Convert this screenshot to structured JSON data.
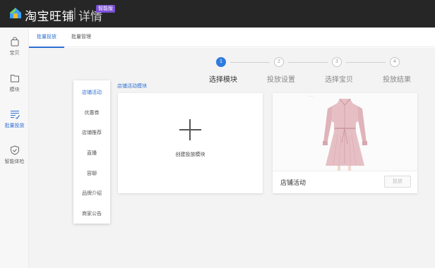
{
  "header": {
    "brand": "淘宝旺铺",
    "separator": "|",
    "subtitle": "详情",
    "badge": "智能版"
  },
  "sidebar": {
    "items": [
      {
        "label": "宝贝",
        "icon": "bag-icon",
        "active": false
      },
      {
        "label": "模块",
        "icon": "folder-icon",
        "active": false
      },
      {
        "label": "批量投放",
        "icon": "list-edit-icon",
        "active": true
      },
      {
        "label": "智能体检",
        "icon": "shield-check-icon",
        "active": false
      }
    ]
  },
  "tabs": [
    {
      "label": "批量投放",
      "active": true
    },
    {
      "label": "批量管理",
      "active": false
    }
  ],
  "steps": [
    {
      "number": "1",
      "label": "选择模块",
      "status": "current"
    },
    {
      "number": "2",
      "label": "投放设置",
      "status": "todo"
    },
    {
      "number": "3",
      "label": "选择宝贝",
      "status": "todo"
    },
    {
      "number": "4",
      "label": "投放结果",
      "status": "todo"
    }
  ],
  "categories": [
    {
      "label": "店铺活动",
      "active": true
    },
    {
      "label": "优惠券",
      "active": false
    },
    {
      "label": "店铺推荐",
      "active": false
    },
    {
      "label": "直播",
      "active": false
    },
    {
      "label": "容聊",
      "active": false
    },
    {
      "label": "品牌介绍",
      "active": false
    },
    {
      "label": "商家公告",
      "active": false
    }
  ],
  "section": {
    "title": "店铺活动模块"
  },
  "create_card": {
    "label": "创建投放模块",
    "icon": "plus-icon"
  },
  "template_card": {
    "name": "店铺活动",
    "button": "投放",
    "image_tag": "- - -",
    "image": "pink-dress-photo"
  },
  "colors": {
    "accent": "#2e6fd2",
    "topbar": "#262626",
    "badge": "#7b4fd6",
    "dress": "#e6bfc4"
  }
}
